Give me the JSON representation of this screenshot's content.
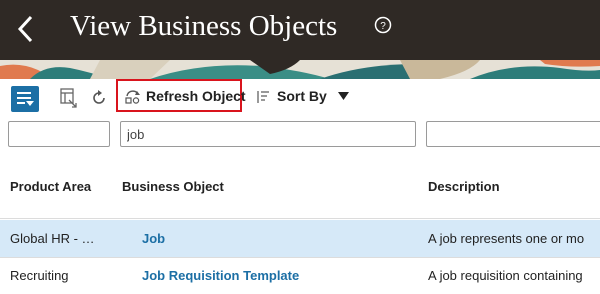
{
  "header": {
    "title": "View Business Objects"
  },
  "toolbar": {
    "refresh_label": "Refresh Object",
    "sort_label": "Sort By"
  },
  "filters": {
    "product_area_value": "",
    "business_object_value": "job",
    "description_value": ""
  },
  "table": {
    "columns": [
      "Product Area",
      "Business Object",
      "Description"
    ],
    "rows": [
      {
        "product_area": "Global HR - …",
        "business_object": "Job",
        "description": "A job represents one or mo",
        "selected": true
      },
      {
        "product_area": "Recruiting",
        "business_object": "Job Requisition Template",
        "description": "A job requisition containing",
        "selected": false
      }
    ]
  },
  "colors": {
    "header_bg": "#2f2925",
    "accent": "#1c6fa5",
    "highlight_border": "#d9141d",
    "selected_row": "#d6e9f8"
  }
}
